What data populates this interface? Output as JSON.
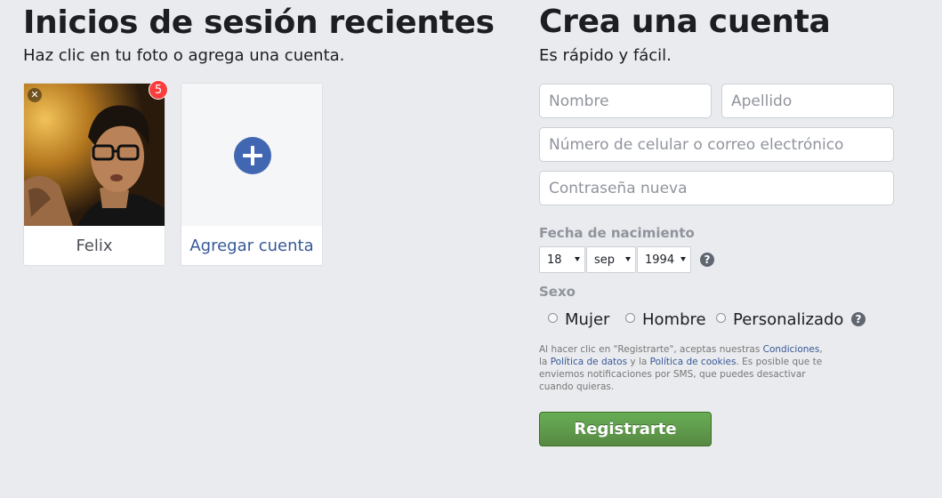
{
  "recent_logins": {
    "title": "Inicios de sesión recientes",
    "subtitle": "Haz clic en tu foto o agrega una cuenta.",
    "accounts": [
      {
        "name": "Felix",
        "notifications": "5",
        "remove_icon": "close-icon"
      }
    ],
    "add_account_label": "Agregar cuenta",
    "add_icon": "plus-icon"
  },
  "signup": {
    "title": "Crea una cuenta",
    "subtitle": "Es rápido y fácil.",
    "first_name_placeholder": "Nombre",
    "last_name_placeholder": "Apellido",
    "contact_placeholder": "Número de celular o correo electrónico",
    "password_placeholder": "Contraseña nueva",
    "dob_label": "Fecha de nacimiento",
    "dob": {
      "day": "18",
      "month": "sep",
      "year": "1994"
    },
    "sex_label": "Sexo",
    "sex_options": [
      "Mujer",
      "Hombre",
      "Personalizado"
    ],
    "help_glyph": "?",
    "legal": {
      "part1": "Al hacer clic en \"Registrarte\", aceptas nuestras ",
      "terms_link": "Condiciones",
      "part2": ", la ",
      "data_policy_link": "Política de datos",
      "part3": " y la ",
      "cookie_policy_link": "Política de cookies",
      "part4": ". Es posible que te enviemos notificaciones por SMS, que puedes desactivar cuando quieras."
    },
    "submit_label": "Registrarte"
  },
  "colors": {
    "background": "#e9ebee",
    "link": "#365899",
    "add_button": "#4267b2",
    "badge": "#fa3e3e",
    "submit": "#67ae55"
  }
}
